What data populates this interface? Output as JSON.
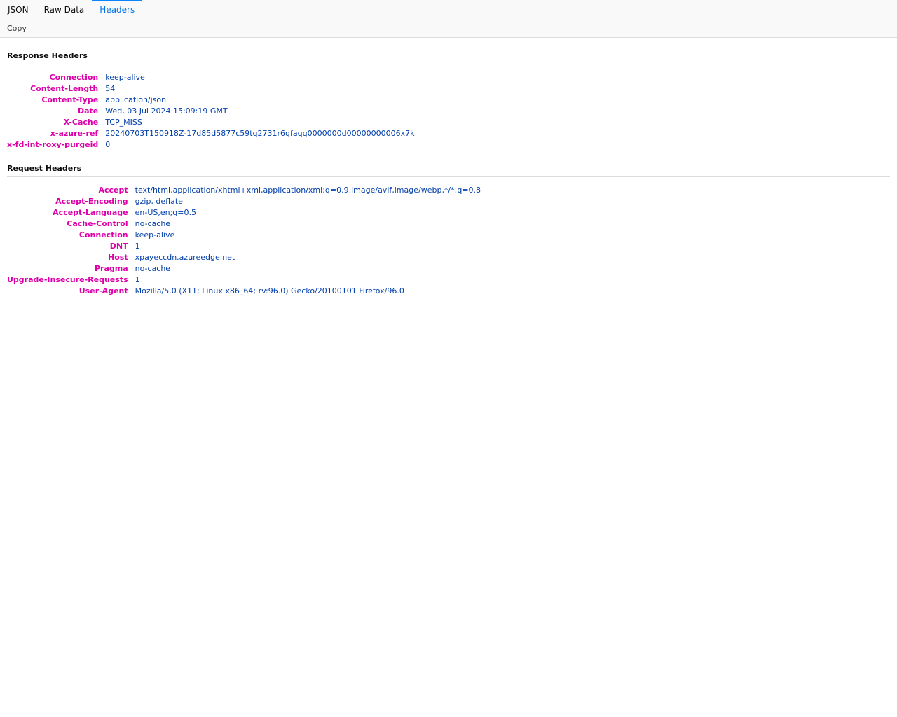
{
  "tabs": [
    {
      "label": "JSON"
    },
    {
      "label": "Raw Data"
    },
    {
      "label": "Headers",
      "active": true
    }
  ],
  "toolbar": {
    "copy_label": "Copy"
  },
  "response": {
    "title": "Response Headers",
    "headers": [
      {
        "name": "Connection",
        "value": "keep-alive"
      },
      {
        "name": "Content-Length",
        "value": "54"
      },
      {
        "name": "Content-Type",
        "value": "application/json"
      },
      {
        "name": "Date",
        "value": "Wed, 03 Jul 2024 15:09:19 GMT"
      },
      {
        "name": "X-Cache",
        "value": "TCP_MISS"
      },
      {
        "name": "x-azure-ref",
        "value": "20240703T150918Z-17d85d5877c59tq2731r6gfaqg0000000d00000000006x7k"
      },
      {
        "name": "x-fd-int-roxy-purgeid",
        "value": "0"
      }
    ]
  },
  "request": {
    "title": "Request Headers",
    "headers": [
      {
        "name": "Accept",
        "value": "text/html,application/xhtml+xml,application/xml;q=0.9,image/avif,image/webp,*/*;q=0.8"
      },
      {
        "name": "Accept-Encoding",
        "value": "gzip, deflate"
      },
      {
        "name": "Accept-Language",
        "value": "en-US,en;q=0.5"
      },
      {
        "name": "Cache-Control",
        "value": "no-cache"
      },
      {
        "name": "Connection",
        "value": "keep-alive"
      },
      {
        "name": "DNT",
        "value": "1"
      },
      {
        "name": "Host",
        "value": "xpayeccdn.azureedge.net"
      },
      {
        "name": "Pragma",
        "value": "no-cache"
      },
      {
        "name": "Upgrade-Insecure-Requests",
        "value": "1"
      },
      {
        "name": "User-Agent",
        "value": "Mozilla/5.0 (X11; Linux x86_64; rv:96.0) Gecko/20100101 Firefox/96.0"
      }
    ]
  },
  "colors": {
    "header_name": "#dd00a9",
    "header_value": "#003eaa",
    "active_tab": "#0074e8"
  }
}
